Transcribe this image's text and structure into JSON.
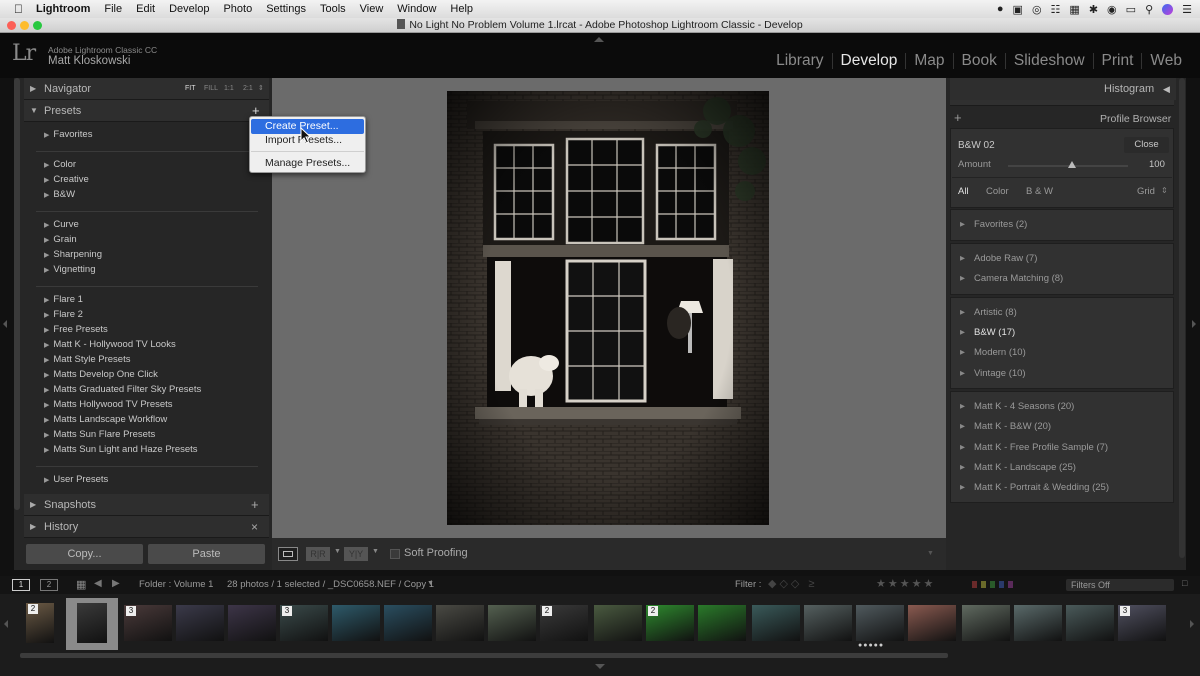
{
  "menubar": {
    "app": "Lightroom",
    "items": [
      "File",
      "Edit",
      "Develop",
      "Photo",
      "Settings",
      "Tools",
      "View",
      "Window",
      "Help"
    ]
  },
  "window": {
    "title": "No Light No Problem Volume 1.lrcat - Adobe Photoshop Lightroom Classic - Develop"
  },
  "identity": {
    "logo": "Lr",
    "app_name": "Adobe Lightroom Classic CC",
    "user": "Matt Kloskowski"
  },
  "modules": [
    {
      "label": "Library",
      "active": false
    },
    {
      "label": "Develop",
      "active": true
    },
    {
      "label": "Map",
      "active": false
    },
    {
      "label": "Book",
      "active": false
    },
    {
      "label": "Slideshow",
      "active": false
    },
    {
      "label": "Print",
      "active": false
    },
    {
      "label": "Web",
      "active": false
    }
  ],
  "navigator": {
    "title": "Navigator",
    "fit": "FIT",
    "fill": "FILL",
    "one": "1:1",
    "two": "2:1"
  },
  "presets": {
    "title": "Presets",
    "add": "+",
    "items": [
      "Favorites",
      "Color",
      "Creative",
      "B&W",
      "Curve",
      "Grain",
      "Sharpening",
      "Vignetting",
      "Flare 1",
      "Flare 2",
      "Free Presets",
      "Matt K - Hollywood TV Looks",
      "Matt Style Presets",
      "Matts Develop One Click",
      "Matts Graduated Filter Sky Presets",
      "Matts Hollywood TV Presets",
      "Matts Landscape Workflow",
      "Matts Sun Flare Presets",
      "Matts Sun Light and Haze Presets",
      "User Presets"
    ]
  },
  "dropdown": {
    "items": [
      "Create Preset...",
      "Import Presets...",
      "Manage Presets..."
    ]
  },
  "snapshots": {
    "title": "Snapshots",
    "add": "+"
  },
  "history": {
    "title": "History",
    "close": "×"
  },
  "buttons": {
    "copy": "Copy...",
    "paste": "Paste"
  },
  "toolbar": {
    "soft_proofing": "Soft Proofing",
    "before_after": "R|R",
    "yy": "Y|Y"
  },
  "right": {
    "histogram": "Histogram",
    "profile_browser": "Profile Browser",
    "profile_name": "B&W 02",
    "close": "Close",
    "amount_label": "Amount",
    "amount_value": "100",
    "amount": 100,
    "filters": [
      "All",
      "Color",
      "B & W"
    ],
    "grid": "Grid",
    "groups": [
      [
        "Favorites (2)"
      ],
      [
        "Adobe Raw (7)",
        "Camera Matching (8)"
      ],
      [
        "Artistic (8)",
        "B&W (17)",
        "Modern (10)",
        "Vintage (10)"
      ],
      [
        "Matt K - 4 Seasons (20)",
        "Matt K - B&W (20)",
        "Matt K - Free Profile Sample (7)",
        "Matt K - Landscape (25)",
        "Matt K - Portrait & Wedding (25)"
      ]
    ]
  },
  "filmbar": {
    "view1": "1",
    "view2": "2",
    "folder": "Folder : Volume 1",
    "count": "28 photos / 1 selected / _DSC0658.NEF / Copy 1",
    "filter_label": "Filter :",
    "filters_off": "Filters Off"
  },
  "thumb_badges": [
    "2",
    "",
    "3",
    "",
    "",
    "3",
    "",
    "",
    "",
    "",
    "2",
    "",
    "2",
    "",
    "",
    "",
    "",
    "",
    "",
    "",
    "",
    "3"
  ]
}
